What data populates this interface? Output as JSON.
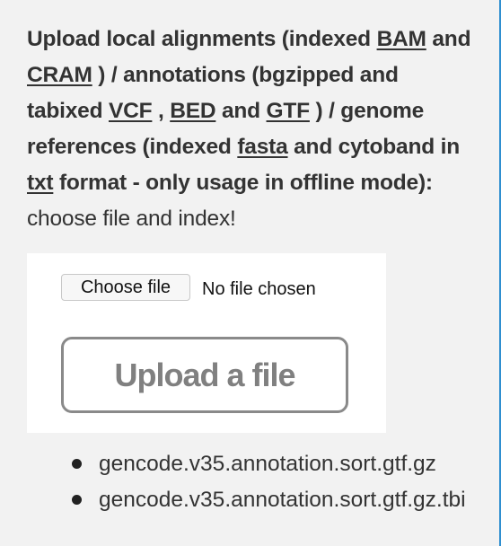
{
  "instructions": {
    "p1": "Upload local alignments (indexed ",
    "bam": "BAM",
    "p2": " and ",
    "cram": "CRAM",
    "p3": " ) / annotations (bgzipped and tabixed ",
    "vcf": "VCF",
    "p4": " , ",
    "bed": "BED",
    "p5": " and ",
    "gtf": "GTF",
    "p6": " ) / genome references (indexed ",
    "fasta": "fasta",
    "p7": " and cytoband in ",
    "txt": "txt",
    "p8": " format - only usage in offline mode):",
    "tail": " choose file and index!"
  },
  "upload": {
    "choose_file_label": "Choose file",
    "file_status": "No file chosen",
    "upload_button_label": "Upload a file"
  },
  "uploaded_files": [
    "gencode.v35.annotation.sort.gtf.gz",
    "gencode.v35.annotation.sort.gtf.gz.tbi"
  ],
  "colors": {
    "page_background": "#f2f2f2",
    "text": "#333333",
    "right_edge_accent": "#2f8fd0"
  }
}
